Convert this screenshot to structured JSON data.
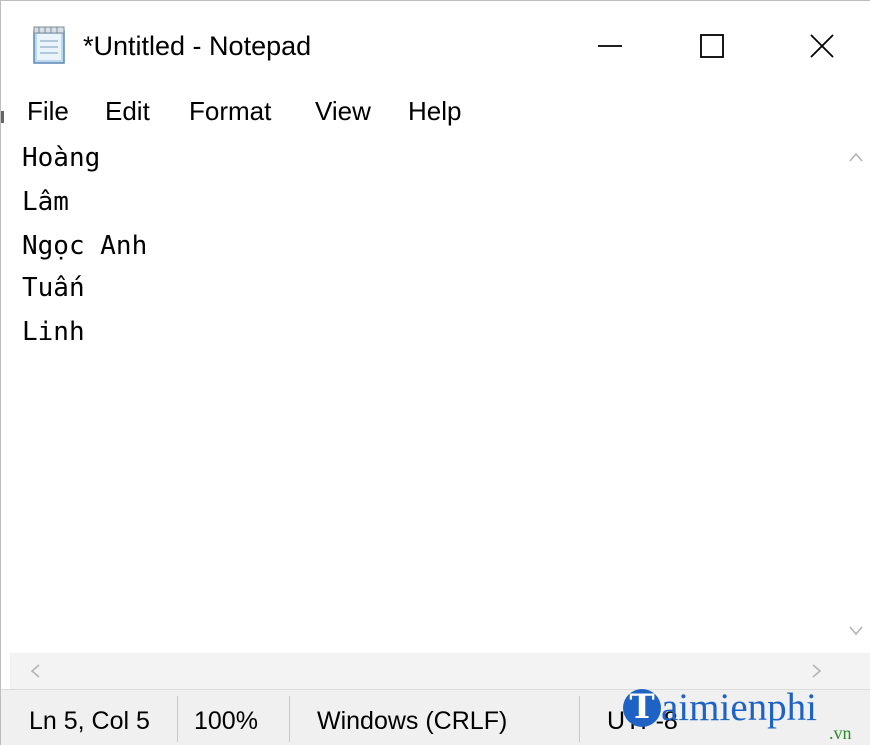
{
  "window": {
    "title": "*Untitled - Notepad",
    "app_icon": "notepad-icon",
    "controls": {
      "minimize_icon": "minimize-icon",
      "maximize_icon": "maximize-icon",
      "close_icon": "close-icon"
    }
  },
  "menu": {
    "items": [
      {
        "label": "File"
      },
      {
        "label": "Edit"
      },
      {
        "label": "Format"
      },
      {
        "label": "View"
      },
      {
        "label": "Help"
      }
    ]
  },
  "editor": {
    "lines": [
      "Hoàng",
      "Lâm",
      "Ngọc Anh",
      "Tuấn",
      "Linh"
    ]
  },
  "scrollbars": {
    "up_icon": "chevron-up-icon",
    "down_icon": "chevron-down-icon",
    "left_icon": "chevron-left-icon",
    "right_icon": "chevron-right-icon"
  },
  "status": {
    "position": "Ln 5, Col 5",
    "zoom": "100%",
    "line_ending": "Windows (CRLF)",
    "encoding": "UTF-8"
  },
  "watermark": {
    "letter": "T",
    "text": "aimienphi",
    "suffix": ".vn",
    "colors": {
      "brand": "#1e63c4",
      "suffix": "#2a8b2a"
    }
  }
}
